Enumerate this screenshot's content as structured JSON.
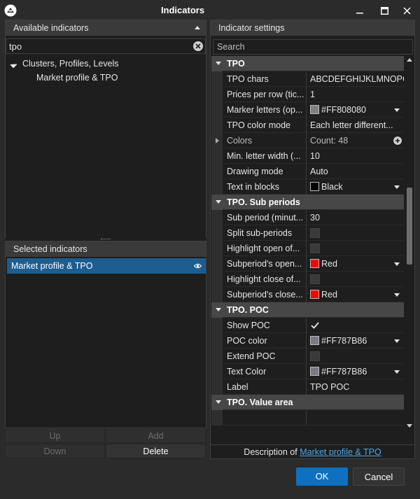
{
  "window": {
    "title": "Indicators"
  },
  "available": {
    "header": "Available indicators",
    "search_value": "tpo",
    "group_label": "Clusters, Profiles, Levels",
    "child_label": "Market profile & TPO"
  },
  "selected": {
    "header": "Selected indicators",
    "item_label": "Market profile & TPO",
    "buttons": {
      "up": "Up",
      "add": "Add",
      "down": "Down",
      "delete": "Delete"
    }
  },
  "settings": {
    "header": "Indicator settings",
    "search_placeholder": "Search",
    "sections": {
      "tpo": "TPO",
      "sub_periods": "TPO. Sub periods",
      "poc": "TPO. POC",
      "value_area": "TPO. Value area"
    },
    "rows": {
      "tpo_chars": {
        "name": "TPO chars",
        "value": "ABCDEFGHIJKLMNOPC"
      },
      "prices_per_row": {
        "name": "Prices per row (tic...",
        "value": "1"
      },
      "marker_letters": {
        "name": "Marker letters (op...",
        "value": "#FF808080",
        "color": "#808080"
      },
      "tpo_color_mode": {
        "name": "TPO color mode",
        "value": "Each letter different..."
      },
      "colors": {
        "name": "Colors",
        "value": "Count: 48"
      },
      "min_letter_width": {
        "name": "Min. letter width (...",
        "value": "10"
      },
      "drawing_mode": {
        "name": "Drawing mode",
        "value": "Auto"
      },
      "text_in_blocks": {
        "name": "Text in blocks",
        "value": "Black",
        "color": "#000000"
      },
      "sub_period": {
        "name": "Sub period (minut...",
        "value": "30"
      },
      "split_sub_periods": {
        "name": "Split sub-periods"
      },
      "highlight_open": {
        "name": "Highlight open of..."
      },
      "subperiod_open": {
        "name": "Subperiod's open...",
        "value": "Red",
        "color": "#ff0000"
      },
      "highlight_close": {
        "name": "Highlight close of..."
      },
      "subperiod_close": {
        "name": "Subperiod's close...",
        "value": "Red",
        "color": "#ff0000"
      },
      "show_poc": {
        "name": "Show POC",
        "checked": true
      },
      "poc_color": {
        "name": "POC color",
        "value": "#FF787B86",
        "color": "#787b86"
      },
      "extend_poc": {
        "name": "Extend POC"
      },
      "text_color": {
        "name": "Text Color",
        "value": "#FF787B86",
        "color": "#787b86"
      },
      "label": {
        "name": "Label",
        "value": "TPO POC"
      }
    },
    "description_prefix": "Description of ",
    "description_link": "Market profile & TPO"
  },
  "footer": {
    "ok": "OK",
    "cancel": "Cancel"
  }
}
